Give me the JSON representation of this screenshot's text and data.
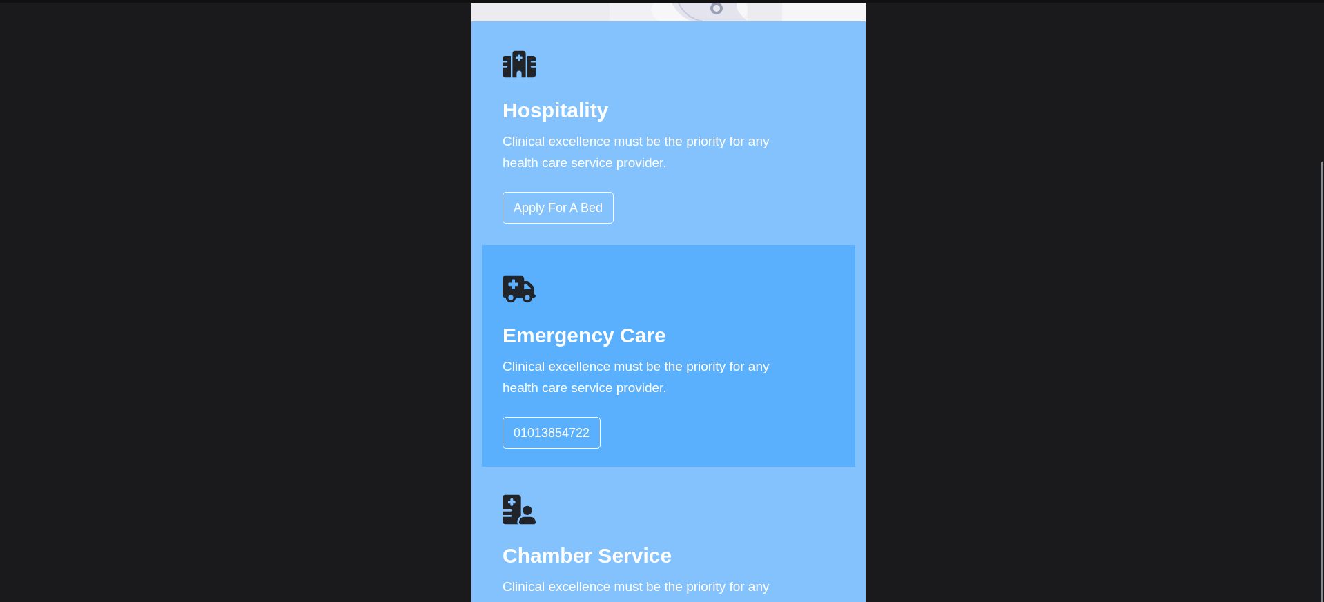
{
  "services": [
    {
      "kind": "hospital",
      "title": "Hospitality",
      "text": "Clinical excellence must be the priority for any health care service provider.",
      "button": "Apply For A Bed",
      "highlighted": false
    },
    {
      "kind": "ambulance",
      "title": "Emergency Care",
      "text": "Clinical excellence must be the priority for any health care service provider.",
      "button": "01013854722",
      "highlighted": true
    },
    {
      "kind": "doctor",
      "title": "Chamber Service",
      "text": "Clinical excellence must be the priority for any",
      "highlighted": false
    }
  ]
}
